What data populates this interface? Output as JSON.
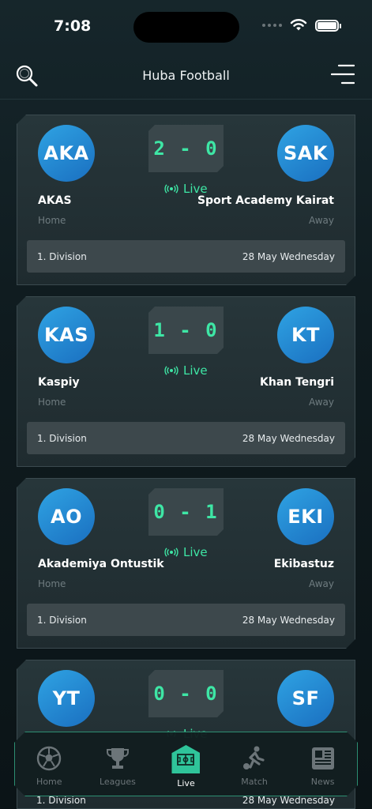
{
  "status": {
    "time": "7:08"
  },
  "header": {
    "title": "Huba Football"
  },
  "matches": [
    {
      "home": {
        "abbr": "AKA",
        "name": "AKAS",
        "side": "Home"
      },
      "away": {
        "abbr": "SAK",
        "name": "Sport Academy Kairat",
        "side": "Away"
      },
      "score": "2 - 0",
      "status": "Live",
      "division": "1. Division",
      "date": "28 May Wednesday"
    },
    {
      "home": {
        "abbr": "KAS",
        "name": "Kaspiy",
        "side": "Home"
      },
      "away": {
        "abbr": "KT",
        "name": "Khan Tengri",
        "side": "Away"
      },
      "score": "1 - 0",
      "status": "Live",
      "division": "1. Division",
      "date": "28 May Wednesday"
    },
    {
      "home": {
        "abbr": "AO",
        "name": "Akademiya Ontustik",
        "side": "Home"
      },
      "away": {
        "abbr": "EKI",
        "name": "Ekibastuz",
        "side": "Away"
      },
      "score": "0 - 1",
      "status": "Live",
      "division": "1. Division",
      "date": "28 May Wednesday"
    },
    {
      "home": {
        "abbr": "YT",
        "name": "",
        "side": ""
      },
      "away": {
        "abbr": "SF",
        "name": "",
        "side": ""
      },
      "score": "0 - 0",
      "status": "Live",
      "division": "1. Division",
      "date": "28 May Wednesday"
    }
  ],
  "tabs": [
    {
      "label": "Home",
      "icon": "soccer-ball-icon"
    },
    {
      "label": "Leagues",
      "icon": "trophy-icon"
    },
    {
      "label": "Live",
      "icon": "pitch-icon",
      "active": true
    },
    {
      "label": "Match",
      "icon": "player-kick-icon"
    },
    {
      "label": "News",
      "icon": "newspaper-icon"
    }
  ],
  "colors": {
    "accent": "#3ee6a5",
    "logo": "#1f8ad6",
    "background": "#0f1b1f"
  }
}
